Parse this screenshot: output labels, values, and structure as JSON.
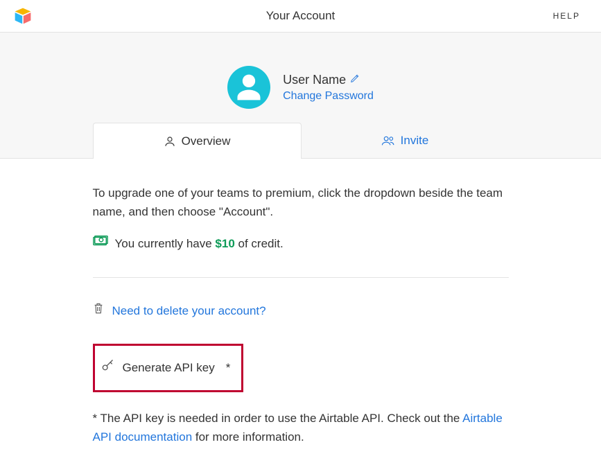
{
  "header": {
    "title": "Your Account",
    "help": "HELP"
  },
  "profile": {
    "username": "User Name",
    "change_password": "Change Password"
  },
  "tabs": {
    "overview": "Overview",
    "invite": "Invite"
  },
  "content": {
    "upgrade_text": "To upgrade one of your teams to premium, click the dropdown beside the team name, and then choose \"Account\".",
    "credit_prefix": "You currently have ",
    "credit_amount": "$10",
    "credit_suffix": " of credit.",
    "delete_account": "Need to delete your account?",
    "generate_api_key": "Generate API key",
    "asterisk": "*",
    "footnote_prefix": "* The API key is needed in order to use the Airtable API. Check out the ",
    "footnote_link": "Airtable API documentation",
    "footnote_suffix": " for more information."
  }
}
